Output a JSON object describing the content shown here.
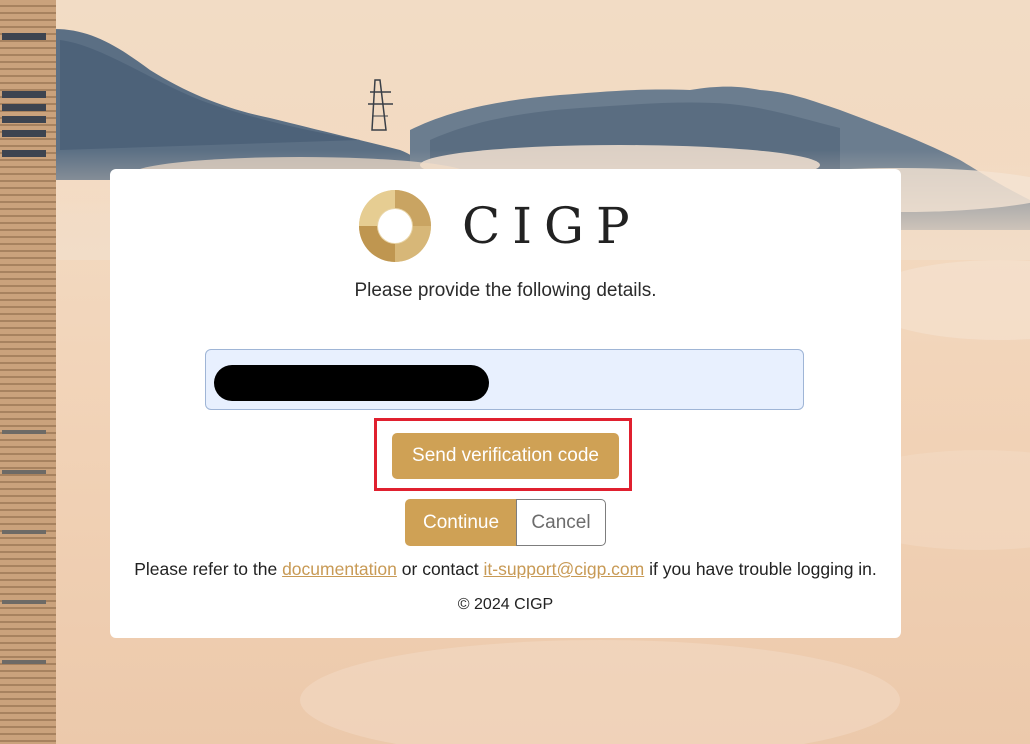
{
  "brand": {
    "name": "CIGP",
    "logo_icon": "cigp-ring-logo-icon",
    "accent_color": "#cfa155"
  },
  "form": {
    "subtitle": "Please provide the following details.",
    "identifier_field": {
      "value": "",
      "redacted": true
    },
    "send_code_label": "Send verification code",
    "continue_label": "Continue",
    "cancel_label": "Cancel"
  },
  "help": {
    "prefix": "Please refer to the",
    "doc_link": "documentation",
    "middle": "or contact",
    "email_link": "it-support@cigp.com",
    "suffix": "if you have trouble logging in."
  },
  "footer": {
    "copyright": "© 2024 CIGP"
  },
  "annotation": {
    "highlight_color": "#e0202f"
  }
}
